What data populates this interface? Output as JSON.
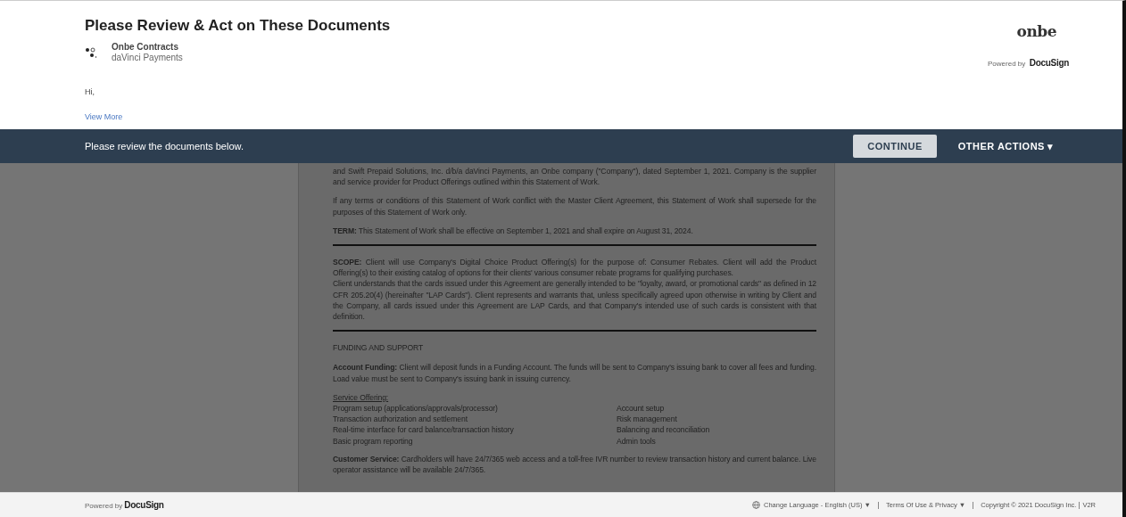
{
  "header": {
    "title": "Please Review & Act on These Documents",
    "sender": {
      "name": "Onbe Contracts",
      "company": "daVinci Payments"
    },
    "brand": {
      "logo": "onbe",
      "powered_by": "Powered by",
      "provider": "DocuSign"
    },
    "greeting": "Hi,",
    "view_more": "View More"
  },
  "action_bar": {
    "message": "Please review the documents below.",
    "buttons": [
      {
        "kind": "primary",
        "label": "CONTINUE"
      },
      {
        "kind": "menu",
        "label": "OTHER ACTIONS",
        "caret": "▾"
      }
    ]
  },
  "document": {
    "blocks": [
      {
        "kind": "paragraph",
        "text": "and Swift Prepaid Solutions, Inc. d/b/a daVinci Payments, an Onbe company (\"Company\"), dated September 1, 2021. Company is the supplier and service provider for Product Offerings outlined within this Statement of Work."
      },
      {
        "kind": "paragraph",
        "text": "If any terms or conditions of this Statement of Work conflict with the Master Client Agreement, this Statement of Work shall supersede for the purposes of this Statement of Work only."
      },
      {
        "kind": "paragraph",
        "text": "**TERM:** This Statement of Work shall be effective on September 1, 2021 and shall expire on August 31, 2024."
      },
      {
        "kind": "rule"
      },
      {
        "kind": "paragraph",
        "text": "**SCOPE:** Client will use Company's Digital Choice Product Offering(s) for the purpose of: Consumer Rebates. Client will add the Product Offering(s) to their existing catalog of options for their clients' various consumer rebate programs for qualifying purchases."
      },
      {
        "kind": "tight",
        "text": "Client understands that the cards issued under this Agreement are generally intended to be \"loyalty, award, or promotional cards\" as defined in 12 CFR 205.20(4) (hereinafter \"LAP Cards\").  Client represents and warrants that, unless specifically agreed upon otherwise in writing by Client and the Company, all cards issued under this Agreement are LAP Cards, and that Company's intended use of such cards is consistent with that definition."
      },
      {
        "kind": "rule"
      },
      {
        "kind": "heading",
        "text": "FUNDING AND SUPPORT"
      },
      {
        "kind": "paragraph",
        "text": "**Account Funding:** Client will deposit funds in a Funding Account. The funds will be sent to Company's issuing bank to cover all fees and funding. Load value must be sent to Company's issuing bank in issuing currency."
      },
      {
        "kind": "list",
        "title": "Service Offering:",
        "items": [
          [
            "Program setup (applications/approvals/processor)",
            "Account setup"
          ],
          [
            "Transaction authorization and settlement",
            "Risk management"
          ],
          [
            "Real-time interface for card balance/transaction history",
            "Balancing and reconciliation"
          ],
          [
            "Basic program reporting",
            "Admin tools"
          ]
        ]
      },
      {
        "kind": "paragraph",
        "text": "**Customer Service:** Cardholders will have 24/7/365 web access and a toll-free IVR number to review transaction history and current balance. Live operator assistance will be available 24/7/365."
      }
    ]
  },
  "footer": {
    "powered_by": "Powered by",
    "provider": "DocuSign",
    "language": "Change Language - English (US)",
    "language_caret": "▼",
    "terms": "Terms Of Use & Privacy",
    "terms_caret": "▼",
    "copyright": "Copyright © 2021 DocuSign Inc.",
    "version": "V2R"
  }
}
